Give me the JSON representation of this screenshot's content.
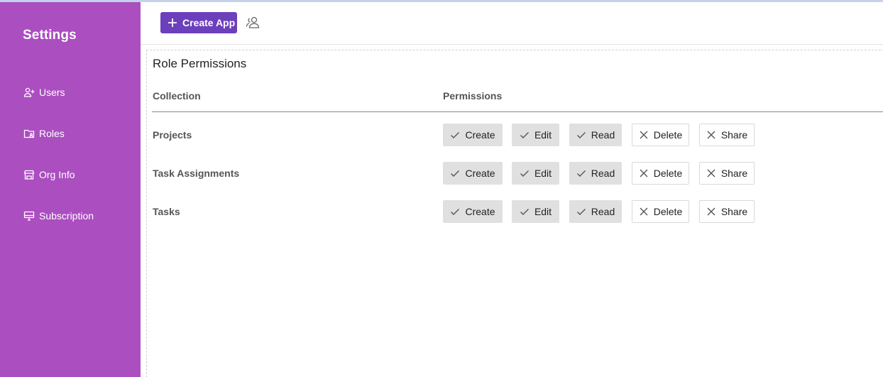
{
  "sidebar": {
    "title": "Settings",
    "items": [
      {
        "label": "Users",
        "icon": "add-user-icon"
      },
      {
        "label": "Roles",
        "icon": "folder-user-icon"
      },
      {
        "label": "Org Info",
        "icon": "store-icon"
      },
      {
        "label": "Subscription",
        "icon": "monitor-icon"
      }
    ]
  },
  "topbar": {
    "create_label": "Create App",
    "create_icon": "plus-icon",
    "users_icon": "people-icon"
  },
  "panel": {
    "title": "Role Permissions",
    "headers": {
      "collection": "Collection",
      "permissions": "Permissions"
    },
    "rows": [
      {
        "name": "Projects",
        "perms": [
          {
            "label": "Create",
            "granted": true
          },
          {
            "label": "Edit",
            "granted": true
          },
          {
            "label": "Read",
            "granted": true
          },
          {
            "label": "Delete",
            "granted": false
          },
          {
            "label": "Share",
            "granted": false
          }
        ]
      },
      {
        "name": "Task Assignments",
        "perms": [
          {
            "label": "Create",
            "granted": true
          },
          {
            "label": "Edit",
            "granted": true
          },
          {
            "label": "Read",
            "granted": true
          },
          {
            "label": "Delete",
            "granted": false
          },
          {
            "label": "Share",
            "granted": false
          }
        ]
      },
      {
        "name": "Tasks",
        "perms": [
          {
            "label": "Create",
            "granted": true
          },
          {
            "label": "Edit",
            "granted": true
          },
          {
            "label": "Read",
            "granted": true
          },
          {
            "label": "Delete",
            "granted": false
          },
          {
            "label": "Share",
            "granted": false
          }
        ]
      }
    ]
  },
  "colors": {
    "sidebar_bg": "#ab4ec0",
    "primary_button": "#6c3fbd",
    "granted_bg": "#e0e0e0",
    "denied_border": "#d9d9d9"
  }
}
